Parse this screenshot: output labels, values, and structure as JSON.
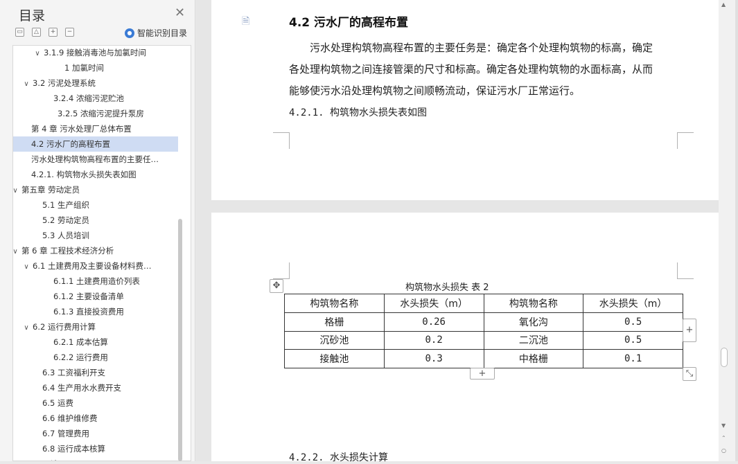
{
  "outline": {
    "title": "目录",
    "close_glyph": "✕",
    "tools": [
      "▭",
      "△",
      "+",
      "−"
    ],
    "smart_label": "智能识别目录",
    "items": [
      {
        "chev": "∨",
        "label": "3.1.9 接触消毒池与加氯时间",
        "indent": 44,
        "selected": false
      },
      {
        "chev": "",
        "label": "1 加氯时间",
        "indent": 74,
        "selected": false
      },
      {
        "chev": "∨",
        "label": "3.2 污泥处理系统",
        "indent": 28,
        "selected": false
      },
      {
        "chev": "",
        "label": "3.2.4 浓缩污泥贮池",
        "indent": 58,
        "selected": false
      },
      {
        "chev": "",
        "label": "3.2.5 浓缩污泥提升泵房",
        "indent": 64,
        "selected": false
      },
      {
        "chev": "",
        "label": "第 4 章  污水处理厂总体布置",
        "indent": 26,
        "selected": false
      },
      {
        "chev": "",
        "label": "4.2 污水厂的高程布置",
        "indent": 26,
        "selected": true
      },
      {
        "chev": "",
        "label": "污水处理构筑物高程布置的主要任…",
        "indent": 26,
        "selected": false
      },
      {
        "chev": "",
        "label": "4.2.1. 构筑物水头损失表如图",
        "indent": 26,
        "selected": false
      },
      {
        "chev": "∨",
        "label": "第五章 劳动定员",
        "indent": 12,
        "selected": false
      },
      {
        "chev": "",
        "label": "5.1 生产组织",
        "indent": 42,
        "selected": false
      },
      {
        "chev": "",
        "label": "5.2 劳动定员",
        "indent": 42,
        "selected": false
      },
      {
        "chev": "",
        "label": "5.3 人员培训",
        "indent": 42,
        "selected": false
      },
      {
        "chev": "∨",
        "label": "第 6 章  工程技术经济分析",
        "indent": 12,
        "selected": false
      },
      {
        "chev": "∨",
        "label": "6.1 土建费用及主要设备材料费…",
        "indent": 28,
        "selected": false
      },
      {
        "chev": "",
        "label": "6.1.1 土建费用造价列表",
        "indent": 58,
        "selected": false
      },
      {
        "chev": "",
        "label": "6.1.2 主要设备清单",
        "indent": 58,
        "selected": false
      },
      {
        "chev": "",
        "label": "6.1.3 直接投资费用",
        "indent": 58,
        "selected": false
      },
      {
        "chev": "∨",
        "label": "6.2 运行费用计算",
        "indent": 28,
        "selected": false
      },
      {
        "chev": "",
        "label": "6.2.1 成本估算",
        "indent": 58,
        "selected": false
      },
      {
        "chev": "",
        "label": "6.2.2 运行费用",
        "indent": 58,
        "selected": false
      },
      {
        "chev": "",
        "label": "6.3 工资福利开支",
        "indent": 42,
        "selected": false
      },
      {
        "chev": "",
        "label": "6.4 生产用水水费开支",
        "indent": 42,
        "selected": false
      },
      {
        "chev": "",
        "label": "6.5 运费",
        "indent": 42,
        "selected": false
      },
      {
        "chev": "",
        "label": "6.6 维护维修费",
        "indent": 42,
        "selected": false
      },
      {
        "chev": "",
        "label": "6.7 管理费用",
        "indent": 42,
        "selected": false
      },
      {
        "chev": "",
        "label": "6.8 运行成本核算",
        "indent": 42,
        "selected": false
      },
      {
        "chev": "",
        "label": "Fo... 论",
        "indent": 26,
        "selected": false
      }
    ]
  },
  "document": {
    "heading": "4.2 污水厂的高程布置",
    "paragraph_lines": [
      "污水处理构筑物高程布置的主要任务是：确定各个处理构筑物的标高，确定",
      "各处理构筑物之间连接管渠的尺寸和标高。确定各处理构筑物的水面标高，从而",
      "能够使污水沿处理构筑物之间顺畅流动，保证污水厂正常运行。"
    ],
    "subheading_1": "4.2.1. 构筑物水头损失表如图",
    "table_caption": "构筑物水头损失  表 2",
    "table": {
      "header": [
        "构筑物名称",
        "水头损失（m）",
        "构筑物名称",
        "水头损失（m）"
      ],
      "rows": [
        [
          "格栅",
          "0.26",
          "氧化沟",
          "0.5"
        ],
        [
          "沉砂池",
          "0.2",
          "二沉池",
          "0.5"
        ],
        [
          "接触池",
          "0.3",
          "中格栅",
          "0.1"
        ]
      ]
    },
    "subheading_2": "4.2.2. 水头损失计算",
    "add_row_glyph": "+",
    "add_col_glyph": "+",
    "move_glyph": "✥",
    "resize_glyph": "⤡",
    "page_icon_glyph": "🗎"
  }
}
